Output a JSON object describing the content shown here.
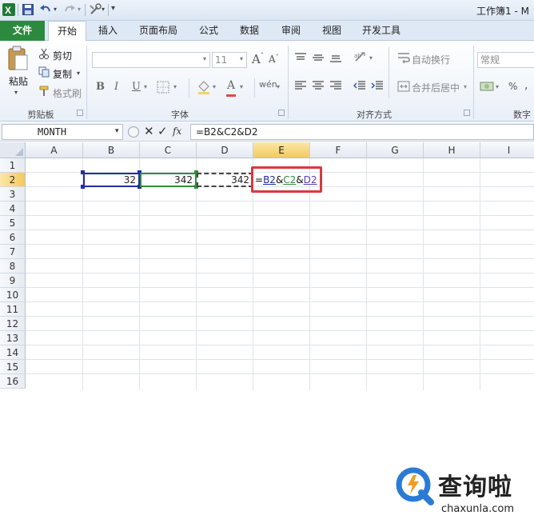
{
  "titlebar": {
    "doc_title": "工作簿1 - M"
  },
  "tabs": [
    "文件",
    "开始",
    "插入",
    "页面布局",
    "公式",
    "数据",
    "审阅",
    "视图",
    "开发工具"
  ],
  "clipboard": {
    "paste": "粘贴",
    "cut": "剪切",
    "copy": "复制",
    "format_painter": "格式刷",
    "group": "剪贴板"
  },
  "font": {
    "size": "11",
    "group": "字体"
  },
  "alignment": {
    "wrap": "自动换行",
    "merge": "合并后居中",
    "group": "对齐方式"
  },
  "number": {
    "format": "常规",
    "percent": "%",
    "group": "数字"
  },
  "formula_bar": {
    "name_box": "MONTH",
    "fx": "fx",
    "formula": "=B2&C2&D2"
  },
  "columns": [
    "A",
    "B",
    "C",
    "D",
    "E",
    "F",
    "G",
    "H",
    "I"
  ],
  "rows": [
    "1",
    "2",
    "3",
    "4",
    "5",
    "6",
    "7",
    "8",
    "9",
    "10",
    "11",
    "12",
    "13",
    "14",
    "15",
    "16"
  ],
  "cells": {
    "B2": "32",
    "C2": "342",
    "D2": "342",
    "E2": "=B2&C2&D2"
  },
  "watermark": {
    "text": "查询啦",
    "url": "chaxunla.com"
  },
  "colors": {
    "file_tab": "#2c8a3e",
    "active_header": "#f4c95d",
    "highlight_box": "#d9393c",
    "ref_b": "#1f2f9e",
    "ref_c": "#2f8f3a",
    "ref_d": "#5b3fb0",
    "watermark_blue": "#2b7bd6",
    "watermark_orange": "#f29c1f"
  }
}
